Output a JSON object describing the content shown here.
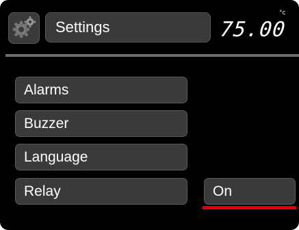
{
  "header": {
    "icon": "gears-icon",
    "title": "Settings",
    "temperature": "75.00",
    "temperature_unit": "°c"
  },
  "menu": {
    "items": [
      {
        "label": "Alarms"
      },
      {
        "label": "Buzzer"
      },
      {
        "label": "Language"
      },
      {
        "label": "Relay"
      }
    ]
  },
  "selected_value": {
    "label": "On",
    "underline_color": "#e00000"
  },
  "colors": {
    "background": "#000000",
    "button": "#3a3a3a",
    "divider": "#6e6e6e"
  }
}
